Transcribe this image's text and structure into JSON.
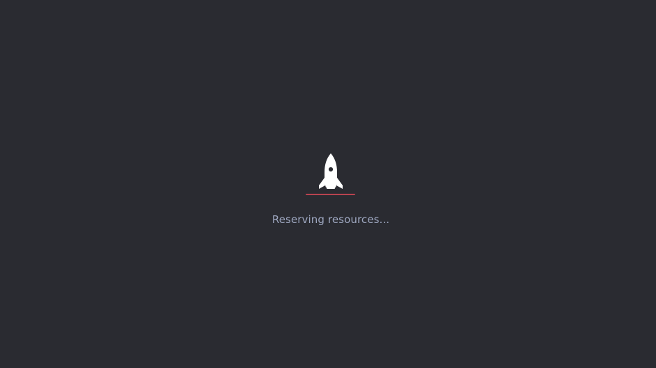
{
  "loader": {
    "status_text": "Reserving resources...",
    "icon": "rocket-icon",
    "colors": {
      "background": "#2a2b31",
      "rocket": "#ffffff",
      "accent_line": "#b8434f",
      "status_text": "#9ea7c0"
    }
  }
}
